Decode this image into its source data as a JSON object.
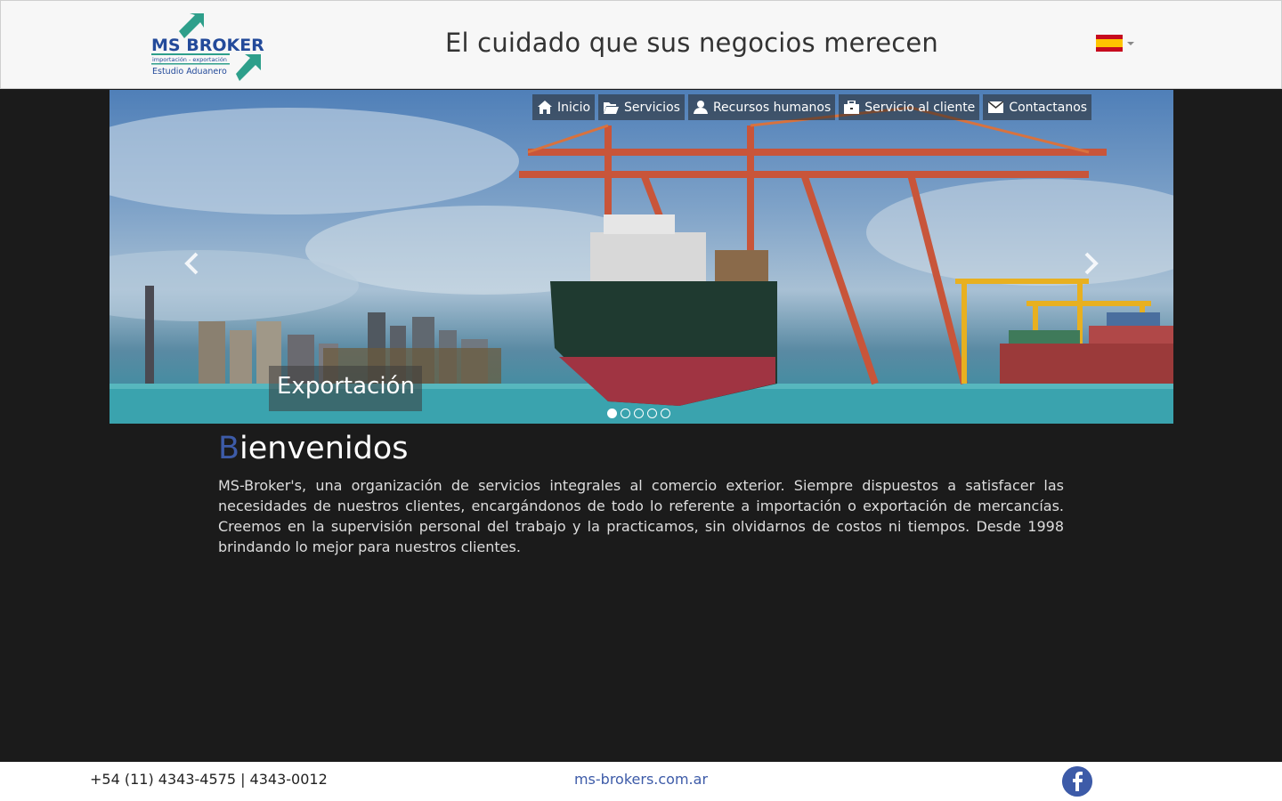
{
  "header": {
    "logo_text": "MS BROKER´S",
    "logo_sub1": "importación - exportación",
    "logo_sub2": "Estudio Aduanero",
    "tagline": "El cuidado que sus negocios merecen",
    "language_icon": "flag-spain-icon"
  },
  "nav": [
    {
      "label": "Inicio",
      "icon": "home-icon"
    },
    {
      "label": "Servicios",
      "icon": "folder-open-icon"
    },
    {
      "label": "Recursos humanos",
      "icon": "user-icon"
    },
    {
      "label": "Servicio al cliente",
      "icon": "briefcase-icon"
    },
    {
      "label": "Contactanos",
      "icon": "envelope-icon"
    }
  ],
  "carousel": {
    "caption": "Exportación",
    "slides_count": 5,
    "active_index": 0
  },
  "main": {
    "welcome_first": "B",
    "welcome_rest": "ienvenidos",
    "intro": "MS-Broker's, una organización de servicios integrales al comercio exterior. Siempre dispuestos a satisfacer las necesidades de nuestros clientes, encargándonos de todo lo referente a importación o exportación de mercancías. Creemos en la supervisión personal del trabajo y la practicamos, sin olvidarnos de costos ni tiempos. Desde 1998 brindando lo mejor para nuestros clientes."
  },
  "footer": {
    "phone": "+54  (11)  4343-4575 | 4343-0012",
    "website": "ms-brokers.com.ar",
    "facebook_icon": "facebook-icon"
  }
}
